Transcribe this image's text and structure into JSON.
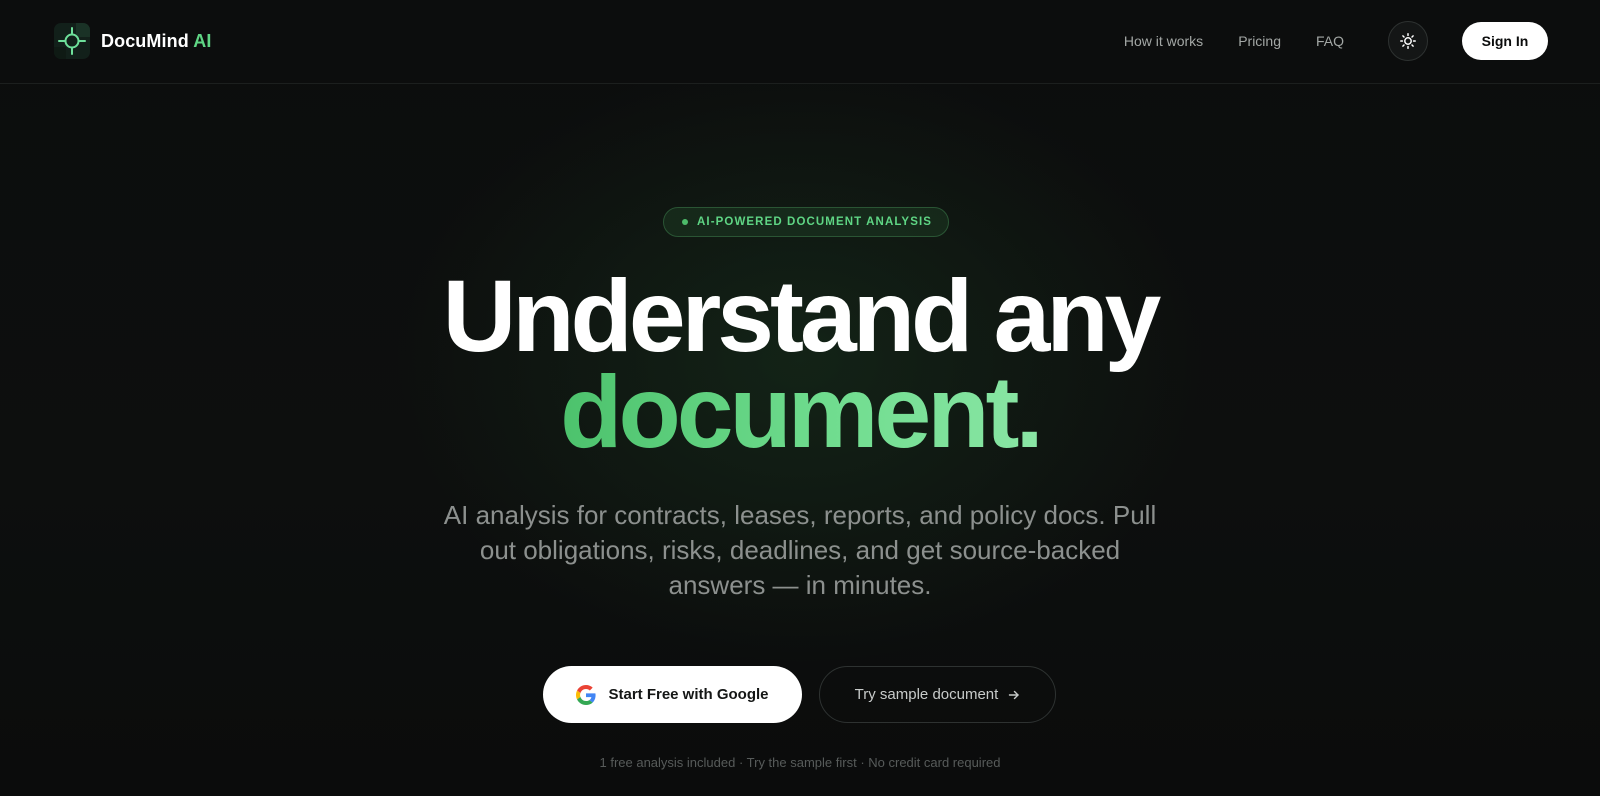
{
  "brand": {
    "name": "DocuMind",
    "accent": "AI",
    "accent_color": "#5fd584",
    "logo_icon": "crosshair-logo-icon"
  },
  "nav": {
    "links": [
      {
        "label": "How it works"
      },
      {
        "label": "Pricing"
      },
      {
        "label": "FAQ"
      }
    ],
    "theme_toggle_icon": "sun-icon",
    "sign_in_label": "Sign In"
  },
  "hero": {
    "badge": "AI-POWERED DOCUMENT ANALYSIS",
    "headline_line1": "Understand any",
    "headline_line2": "document.",
    "subtitle": "AI analysis for contracts, leases, reports, and policy docs. Pull out obligations, risks, deadlines, and get source-backed answers — in minutes.",
    "primary_cta": {
      "label": "Start Free with Google",
      "icon": "google-icon"
    },
    "secondary_cta": {
      "label": "Try sample document",
      "icon": "arrow-right-icon"
    },
    "footnote": "1 free analysis included · Try the sample first · No credit card required"
  },
  "colors": {
    "background": "#0b0c0c",
    "accent_green": "#5fd584",
    "primary_button": "#ffffff"
  }
}
